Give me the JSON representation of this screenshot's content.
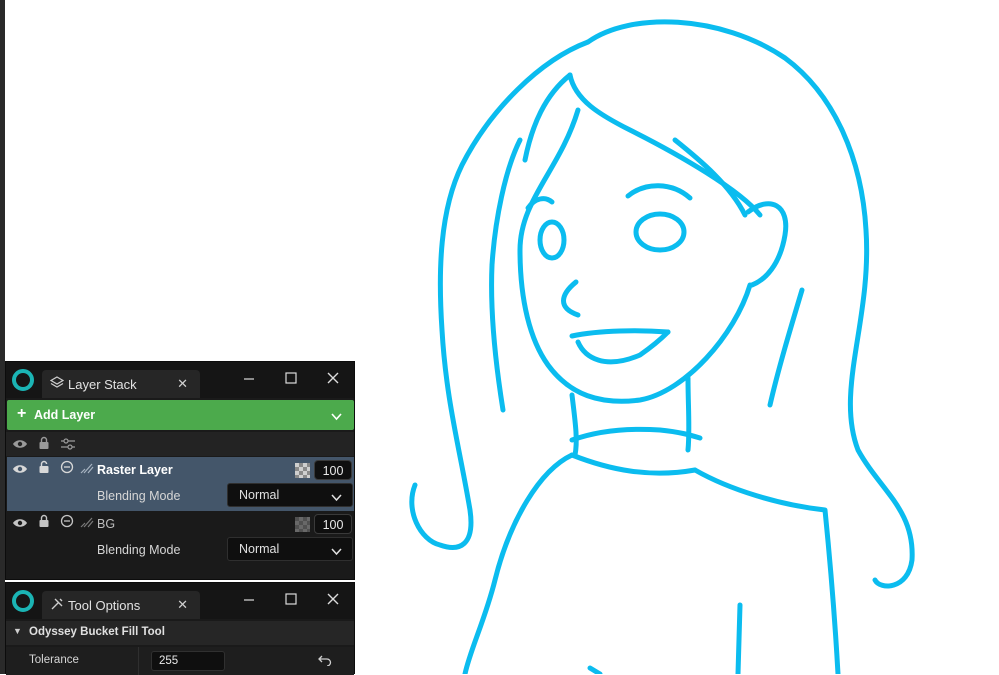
{
  "layer_stack": {
    "tab_title": "Layer Stack",
    "add_layer_label": "Add Layer",
    "layers": [
      {
        "name": "Raster Layer",
        "opacity": "100",
        "blending_label": "Blending Mode",
        "blending_value": "Normal",
        "selected": true
      },
      {
        "name": "BG",
        "opacity": "100",
        "blending_label": "Blending Mode",
        "blending_value": "Normal",
        "selected": false
      }
    ]
  },
  "tool_options": {
    "tab_title": "Tool Options",
    "section_title": "Odyssey Bucket Fill Tool",
    "properties": [
      {
        "label": "Tolerance",
        "value": "255"
      }
    ]
  },
  "colors": {
    "sketch_stroke": "#0bbcef",
    "add_layer_green": "#4caa4c",
    "selected_row": "#44566a",
    "logo_teal": "#1bb4b4"
  },
  "icons": {
    "window": [
      "app-logo-icon",
      "minimize-icon",
      "maximize-icon",
      "close-icon"
    ],
    "layer_row": [
      "eye-icon",
      "lock-icon",
      "alpha-lock-icon",
      "brush-icon",
      "checker-icon"
    ]
  }
}
